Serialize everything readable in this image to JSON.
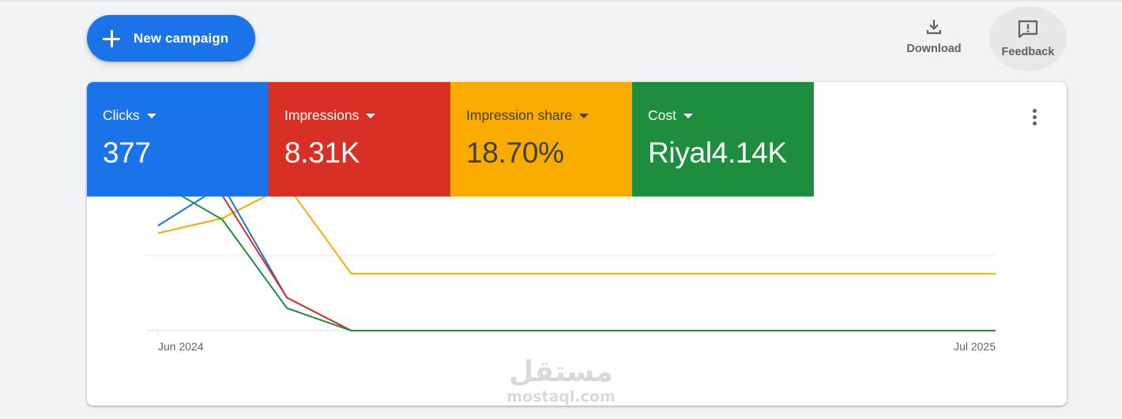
{
  "toolbar": {
    "new_campaign_label": "New campaign",
    "download_label": "Download",
    "feedback_label": "Feedback"
  },
  "metrics": [
    {
      "label": "Clicks",
      "value": "377",
      "color": "#1a73e8"
    },
    {
      "label": "Impressions",
      "value": "8.31K",
      "color": "#d93025"
    },
    {
      "label": "Impression share",
      "value": "18.70%",
      "color": "#f9ab00"
    },
    {
      "label": "Cost",
      "value": "Riyal4.14K",
      "color": "#1e8e3e"
    }
  ],
  "watermark": {
    "top": "مستقل",
    "bottom": "mostaql.com"
  },
  "chart_data": {
    "type": "line",
    "x_labels": [
      "Jun 2024",
      "Jul 2025"
    ],
    "ylim": [
      0,
      100
    ],
    "gridlines": [
      0,
      50,
      100
    ],
    "series": [
      {
        "color": "#1a73e8",
        "values": [
          70,
          97,
          22,
          0,
          0,
          0,
          0,
          0,
          0,
          0,
          0,
          0,
          0,
          0
        ]
      },
      {
        "color": "#d93025",
        "values": [
          96,
          90,
          22,
          0,
          0,
          0,
          0,
          0,
          0,
          0,
          0,
          0,
          0,
          0
        ]
      },
      {
        "color": "#f9ab00",
        "values": [
          65,
          75,
          97,
          38,
          38,
          38,
          38,
          38,
          38,
          38,
          38,
          38,
          38,
          38
        ]
      },
      {
        "color": "#1e8e3e",
        "values": [
          99,
          74,
          15,
          0,
          0,
          0,
          0,
          0,
          0,
          0,
          0,
          0,
          0,
          0
        ]
      }
    ]
  }
}
